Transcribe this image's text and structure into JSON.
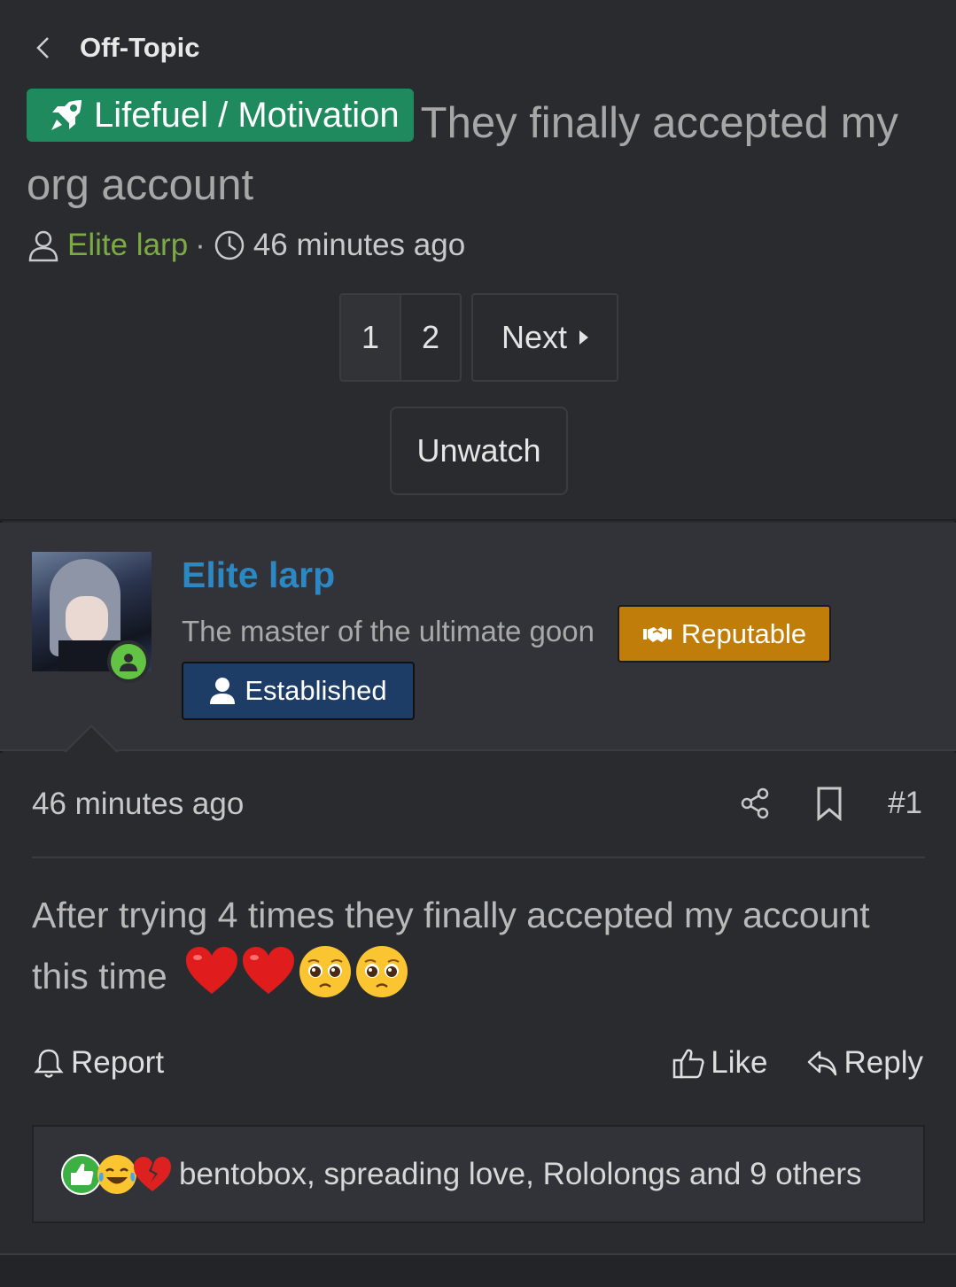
{
  "breadcrumb": {
    "label": "Off-Topic"
  },
  "thread": {
    "prefix": "Lifefuel / Motivation",
    "title": "They finally accepted my org account",
    "author": "Elite larp",
    "time": "46 minutes ago"
  },
  "pagination": {
    "pages": [
      "1",
      "2"
    ],
    "current": "1",
    "next_label": "Next"
  },
  "watch": {
    "label": "Unwatch"
  },
  "user": {
    "name": "Elite larp",
    "title": "The master of the ultimate goon",
    "badges": {
      "reputable": "Reputable",
      "established": "Established"
    },
    "colors": {
      "name": "#2c88c4",
      "reputable": "#c07d09",
      "established": "#1e3d66",
      "online": "#63c345"
    }
  },
  "post": {
    "time": "46 minutes ago",
    "number": "#1",
    "text": "After trying 4 times they finally accepted my account this time",
    "emojis": [
      "red-heart",
      "red-heart",
      "pleading-face",
      "pleading-face"
    ],
    "actions": {
      "report": "Report",
      "like": "Like",
      "reply": "Reply"
    }
  },
  "reactions": {
    "icons": [
      "like-reaction",
      "laughing-reaction",
      "broken-heart-reaction"
    ],
    "summary": "bentobox, spreading love, Rololongs and 9 others"
  },
  "colors": {
    "background": "#2a2b2f",
    "prefix": "#1f8a5e",
    "author": "#7cab43"
  }
}
